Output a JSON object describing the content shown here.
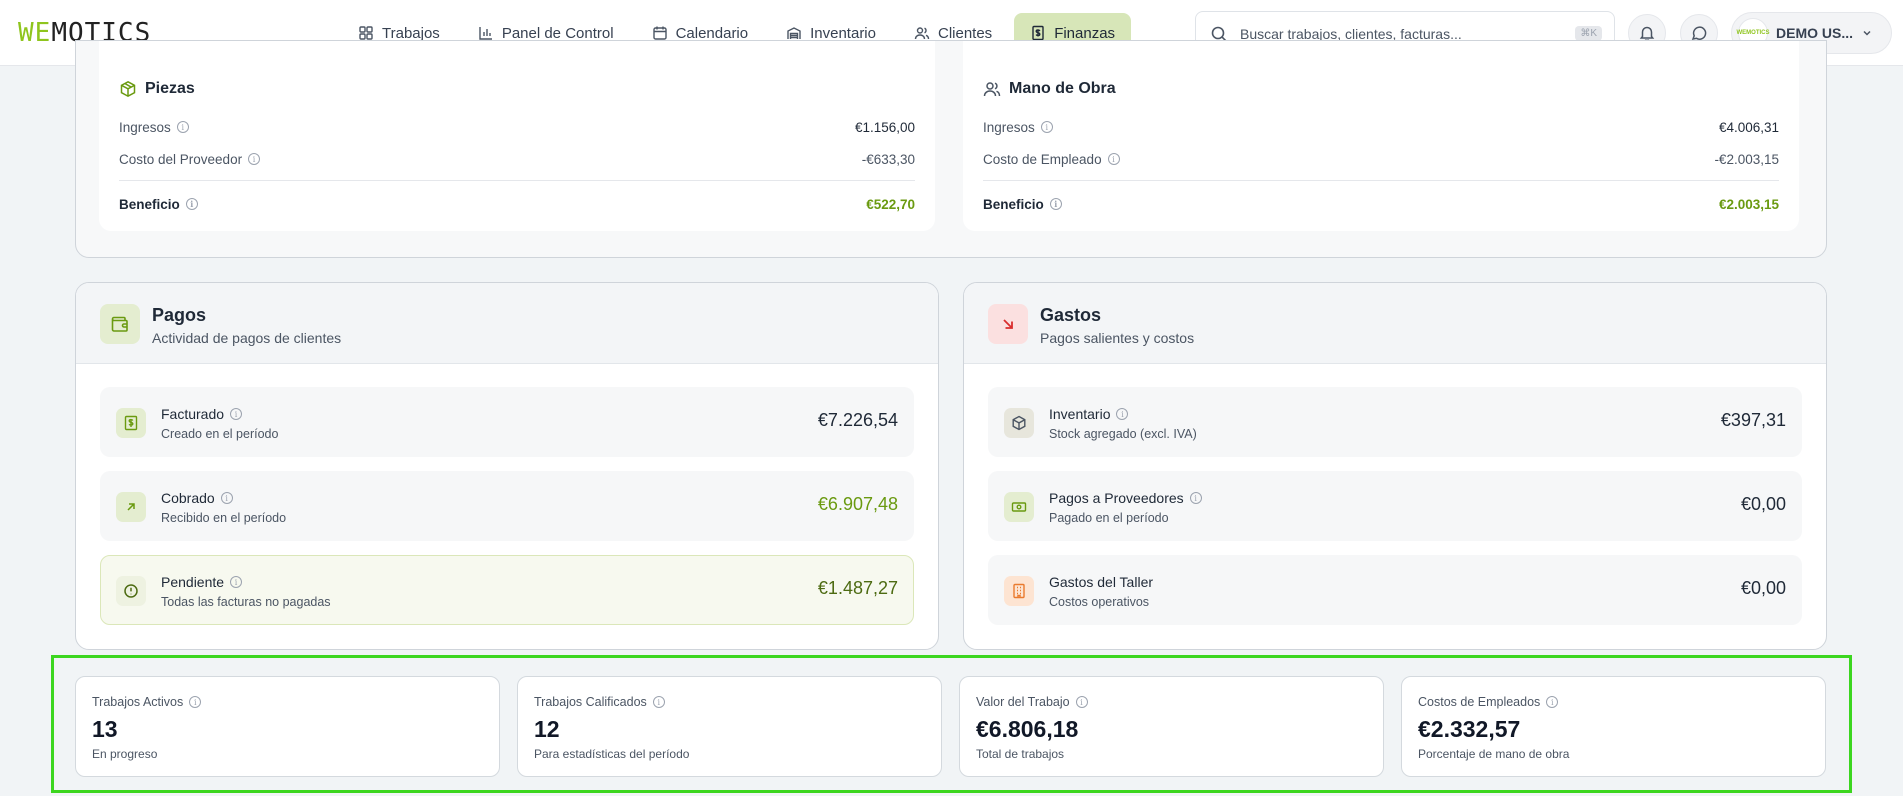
{
  "app": {
    "logo_part1": "WE",
    "logo_part2": "MOTICS"
  },
  "nav": [
    {
      "label": "Trabajos",
      "icon": "grid-icon"
    },
    {
      "label": "Panel de Control",
      "icon": "bar-chart-icon"
    },
    {
      "label": "Calendario",
      "icon": "calendar-icon"
    },
    {
      "label": "Inventario",
      "icon": "warehouse-icon"
    },
    {
      "label": "Clientes",
      "icon": "users-icon"
    },
    {
      "label": "Finanzas",
      "icon": "receipt-icon",
      "active": true
    }
  ],
  "search": {
    "placeholder": "Buscar trabajos, clientes, facturas...",
    "shortcut": "⌘K"
  },
  "user": {
    "name": "DEMO US...",
    "avatar_text": "WEMOTICS"
  },
  "piezas": {
    "title": "Piezas",
    "rows": [
      {
        "label": "Ingresos",
        "value": "€1.156,00"
      },
      {
        "label": "Costo del Proveedor",
        "value": "-€633,30"
      },
      {
        "label": "Beneficio",
        "value": "€522,70"
      }
    ]
  },
  "mano_de_obra": {
    "title": "Mano de Obra",
    "rows": [
      {
        "label": "Ingresos",
        "value": "€4.006,31"
      },
      {
        "label": "Costo de Empleado",
        "value": "-€2.003,15"
      },
      {
        "label": "Beneficio",
        "value": "€2.003,15"
      }
    ]
  },
  "pagos": {
    "title": "Pagos",
    "subtitle": "Actividad de pagos de clientes",
    "items": [
      {
        "title": "Facturado",
        "subtitle": "Creado en el período",
        "value": "€7.226,54"
      },
      {
        "title": "Cobrado",
        "subtitle": "Recibido en el período",
        "value": "€6.907,48"
      },
      {
        "title": "Pendiente",
        "subtitle": "Todas las facturas no pagadas",
        "value": "€1.487,27"
      }
    ]
  },
  "gastos": {
    "title": "Gastos",
    "subtitle": "Pagos salientes y costos",
    "items": [
      {
        "title": "Inventario",
        "subtitle": "Stock agregado (excl. IVA)",
        "value": "€397,31"
      },
      {
        "title": "Pagos a Proveedores",
        "subtitle": "Pagado en el período",
        "value": "€0,00"
      },
      {
        "title": "Gastos del Taller",
        "subtitle": "Costos operativos",
        "value": "€0,00"
      }
    ]
  },
  "stats": [
    {
      "label": "Trabajos Activos",
      "value": "13",
      "subtitle": "En progreso"
    },
    {
      "label": "Trabajos Calificados",
      "value": "12",
      "subtitle": "Para estadísticas del período"
    },
    {
      "label": "Valor del Trabajo",
      "value": "€6.806,18",
      "subtitle": "Total de trabajos"
    },
    {
      "label": "Costos de Empleados",
      "value": "€2.332,57",
      "subtitle": "Porcentaje de mano de obra"
    }
  ],
  "colors": {
    "accent": "#8fc51e",
    "positive": "#6a9a10",
    "active_nav": "#d7e6b8",
    "highlight_outline": "#3cd61f"
  }
}
